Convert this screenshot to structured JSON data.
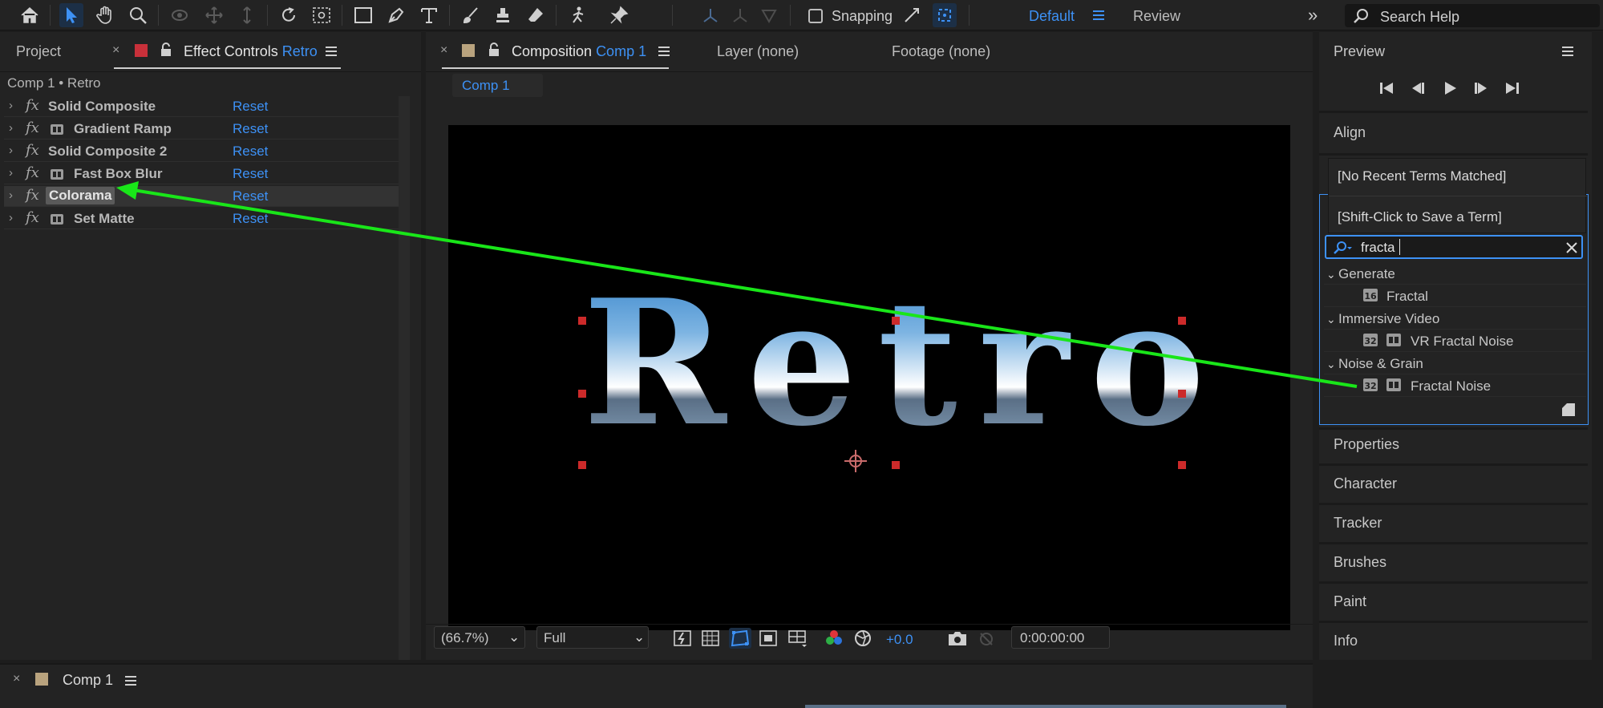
{
  "toolbar": {
    "snapping_label": "Snapping",
    "workspace_active": "Default",
    "workspace_other": "Review",
    "search_help_placeholder": "Search Help",
    "icons": [
      "home-icon",
      "selection-tool-icon",
      "hand-tool-icon",
      "zoom-tool-icon",
      "orbit-camera-icon",
      "pan-camera-icon",
      "dolly-camera-icon",
      "rotate-tool-icon",
      "pan-behind-icon",
      "rectangle-tool-icon",
      "pen-tool-icon",
      "type-tool-icon",
      "brush-tool-icon",
      "clone-stamp-icon",
      "eraser-tool-icon",
      "roto-brush-icon",
      "puppet-pin-icon"
    ]
  },
  "left_panel": {
    "tab_project": "Project",
    "tab_effect_controls": "Effect Controls",
    "tab_effect_controls_layer": "Retro",
    "breadcrumb": "Comp 1 • Retro",
    "effects": [
      {
        "name": "Solid Composite",
        "reset": "Reset",
        "has_preset_icon": false,
        "selected": false
      },
      {
        "name": "Gradient Ramp",
        "reset": "Reset",
        "has_preset_icon": true,
        "selected": false
      },
      {
        "name": "Solid Composite 2",
        "reset": "Reset",
        "has_preset_icon": false,
        "selected": false
      },
      {
        "name": "Fast Box Blur",
        "reset": "Reset",
        "has_preset_icon": true,
        "selected": false
      },
      {
        "name": "Colorama",
        "reset": "Reset",
        "has_preset_icon": false,
        "selected": true
      },
      {
        "name": "Set Matte",
        "reset": "Reset",
        "has_preset_icon": true,
        "selected": false
      }
    ]
  },
  "center_panel": {
    "tab_composition": "Composition",
    "tab_composition_name": "Comp 1",
    "tab_layer": "Layer",
    "tab_layer_value": "(none)",
    "tab_footage": "Footage",
    "tab_footage_value": "(none)",
    "comp_subtab": "Comp 1",
    "canvas_text": "Retro",
    "footer": {
      "magnification": "(66.7%)",
      "resolution": "Full",
      "exposure": "+0.0",
      "timecode": "0:00:00:00"
    }
  },
  "right_panel": {
    "preview_title": "Preview",
    "align_title": "Align",
    "recent_terms": "[No Recent Terms Matched]",
    "shift_click_hint": "[Shift-Click to Save a Term]",
    "search_value": "fracta",
    "categories": [
      {
        "name": "Generate",
        "items": [
          {
            "label": "Fractal",
            "badges": [
              "16"
            ]
          }
        ]
      },
      {
        "name": "Immersive Video",
        "items": [
          {
            "label": "VR Fractal Noise",
            "badges": [
              "32",
              "fx"
            ]
          }
        ]
      },
      {
        "name": "Noise & Grain",
        "items": [
          {
            "label": "Fractal Noise",
            "badges": [
              "32",
              "fx"
            ]
          }
        ]
      }
    ],
    "properties_title": "Properties",
    "character_title": "Character",
    "tracker_title": "Tracker",
    "brushes_title": "Brushes",
    "paint_title": "Paint",
    "info_title": "Info"
  },
  "timeline": {
    "tab": "Comp 1"
  },
  "colors": {
    "accent_blue": "#3d91f5",
    "annotation_green": "#19e619",
    "handle_red": "#d12a2a",
    "label_red": "#c8303a",
    "label_tan": "#b9a37e"
  }
}
